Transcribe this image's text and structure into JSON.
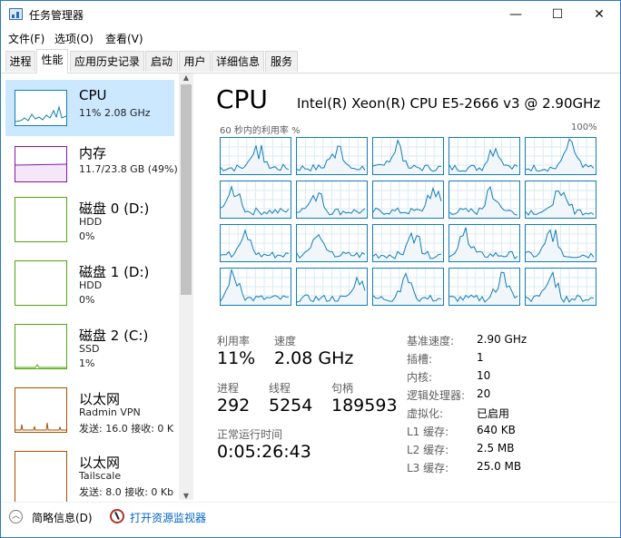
{
  "window": {
    "title": "任务管理器",
    "buttons": {
      "minimize": "—",
      "maximize": "☐",
      "close": "✕"
    }
  },
  "menu": [
    "文件(F)",
    "选项(O)",
    "查看(V)"
  ],
  "tabs": [
    "进程",
    "性能",
    "应用历史记录",
    "启动",
    "用户",
    "详细信息",
    "服务"
  ],
  "active_tab": "性能",
  "resources": [
    {
      "title": "CPU",
      "sub1": "11% 2.08 GHz",
      "sub2": "",
      "color": "#117dbb"
    },
    {
      "title": "内存",
      "sub1": "11.7/23.8 GB (49%)",
      "sub2": "",
      "color": "#8b12ae"
    },
    {
      "title": "磁盘 0 (D:)",
      "sub1": "HDD",
      "sub2": "0%",
      "color": "#4da60c"
    },
    {
      "title": "磁盘 1 (D:)",
      "sub1": "HDD",
      "sub2": "0%",
      "color": "#4da60c"
    },
    {
      "title": "磁盘 2 (C:)",
      "sub1": "SSD",
      "sub2": "1%",
      "color": "#4da60c"
    },
    {
      "title": "以太网",
      "sub1": "Radmin VPN",
      "sub2": "发送: 16.0  接收: 0 K",
      "color": "#a74f01"
    },
    {
      "title": "以太网",
      "sub1": "Tailscale",
      "sub2": "发送: 8.0  接收: 0 Kb",
      "color": "#a74f01"
    }
  ],
  "cpu": {
    "heading": "CPU",
    "model": "Intel(R) Xeon(R) CPU E5-2666 v3 @ 2.90GHz",
    "graph_label": "60 秒内的利用率 %",
    "graph_max": "100%",
    "logical_processor_graphs": 20,
    "stats": {
      "utilization_label": "利用率",
      "utilization": "11%",
      "speed_label": "速度",
      "speed": "2.08 GHz",
      "processes_label": "进程",
      "processes": "292",
      "threads_label": "线程",
      "threads": "5254",
      "handles_label": "句柄",
      "handles": "189593",
      "uptime_label": "正常运行时间",
      "uptime": "0:05:26:43"
    },
    "details": [
      {
        "k": "基准速度:",
        "v": "2.90 GHz"
      },
      {
        "k": "插槽:",
        "v": "1"
      },
      {
        "k": "内核:",
        "v": "10"
      },
      {
        "k": "逻辑处理器:",
        "v": "20"
      },
      {
        "k": "虚拟化:",
        "v": "已启用"
      },
      {
        "k": "L1 缓存:",
        "v": "640 KB"
      },
      {
        "k": "L2 缓存:",
        "v": "2.5 MB"
      },
      {
        "k": "L3 缓存:",
        "v": "25.0 MB"
      }
    ]
  },
  "footer": {
    "summary": "简略信息(D)",
    "resmon": "打开资源监视器"
  },
  "colors": {
    "cpu": "#117dbb",
    "memory": "#8b12ae",
    "disk": "#4da60c",
    "ethernet": "#a74f01",
    "selected": "#cce8ff"
  }
}
